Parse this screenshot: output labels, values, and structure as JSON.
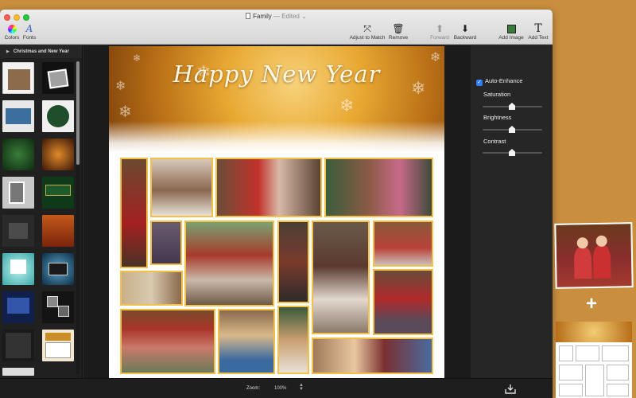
{
  "window": {
    "title": "Family",
    "title_suffix": "— Edited"
  },
  "toolbar": {
    "colors_label": "Colors",
    "fonts_label": "Fonts",
    "adjust_label": "Adjust to Match",
    "remove_label": "Remove",
    "forward_label": "Forward",
    "backward_label": "Backward",
    "add_image_label": "Add Image",
    "add_text_label": "Add Text"
  },
  "sidebar": {
    "section_title": "Christmas and New Year"
  },
  "canvas": {
    "greeting": "Happy New Year"
  },
  "adjustments": {
    "auto_enhance_label": "Auto-Enhance",
    "auto_enhance_checked": true,
    "saturation_label": "Saturation",
    "brightness_label": "Brightness",
    "contrast_label": "Contrast"
  },
  "status": {
    "zoom_label": "Zoom:",
    "zoom_value": "100%"
  },
  "colors": {
    "accent": "#2d7ef7",
    "frame_gold": "#f3c04a",
    "desktop": "#c98f3e"
  }
}
